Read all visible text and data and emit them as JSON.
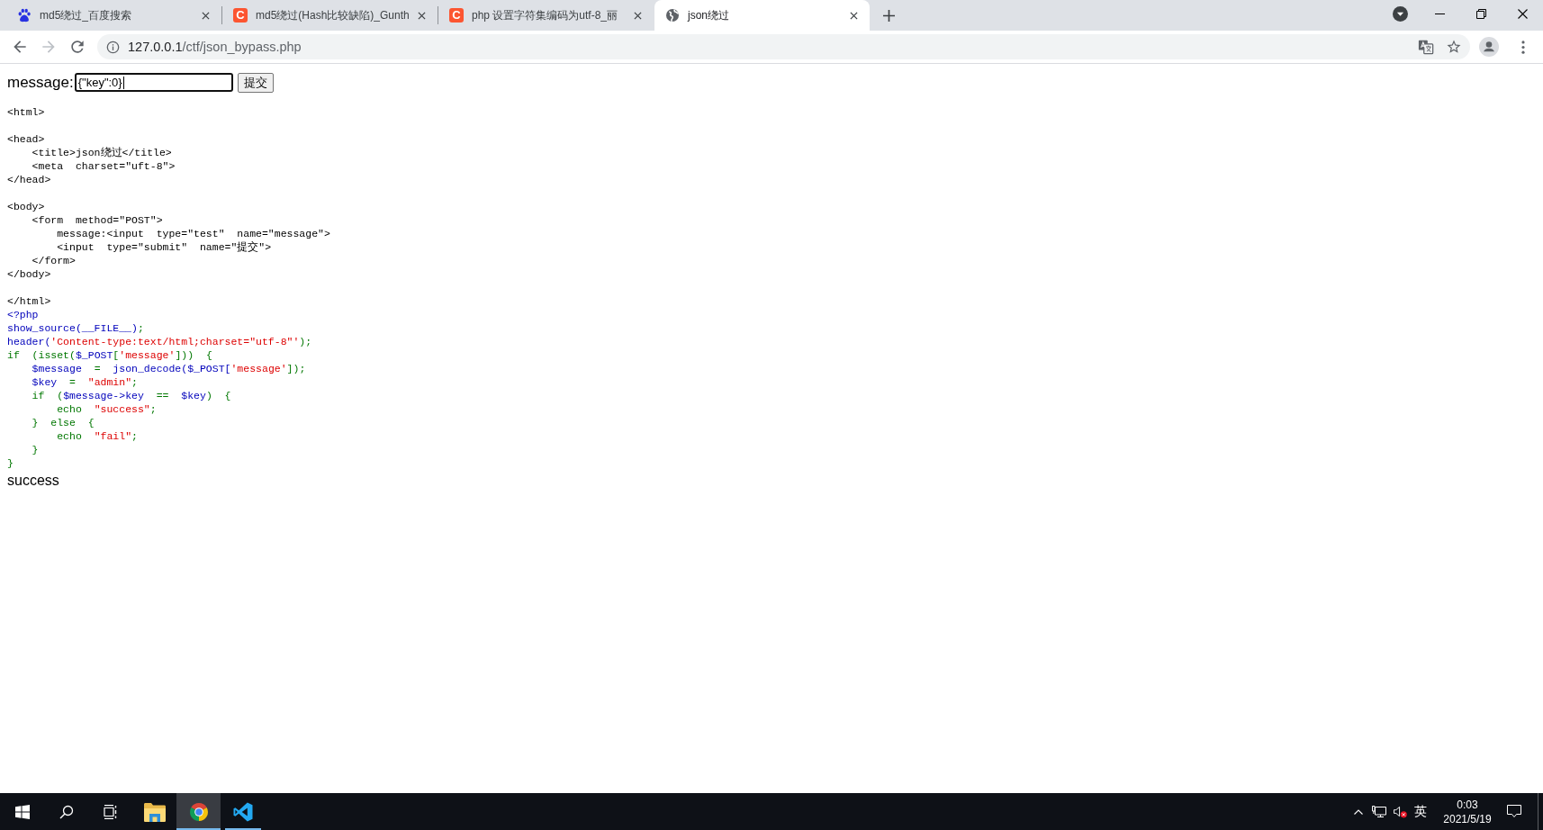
{
  "browser": {
    "tabs": [
      {
        "title": "md5绕过_百度搜索",
        "kind": "paw",
        "selected": false
      },
      {
        "title": "md5绕过(Hash比较缺陷)_Gunth",
        "kind": "letter",
        "favicon_letter": "C",
        "selected": false
      },
      {
        "title": "php 设置字符集编码为utf-8_丽",
        "kind": "letter",
        "favicon_letter": "C",
        "selected": false
      },
      {
        "title": "json绕过",
        "kind": "globe",
        "selected": true
      }
    ],
    "can_go_forward": false,
    "address_bar": {
      "host": "127.0.0.1",
      "path": "/ctf/json_bypass.php"
    }
  },
  "page": {
    "form": {
      "label": "message:",
      "input_value": "{\"key\":0}",
      "focused": true,
      "submit": "提交"
    },
    "source": {
      "blocks": [
        {
          "lines": [
            [
              {
                "kind": "html",
                "text": "<html>"
              }
            ]
          ]
        },
        {
          "lines": [
            [
              {
                "kind": "html",
                "text": "<head>"
              }
            ],
            [
              {
                "kind": "html",
                "text": "    <title>json绕过</title>"
              }
            ],
            [
              {
                "kind": "html",
                "text": "    <meta  charset=\"uft-8\">"
              }
            ],
            [
              {
                "kind": "html",
                "text": "</head>"
              }
            ]
          ]
        },
        {
          "lines": [
            [
              {
                "kind": "html",
                "text": "<body>"
              }
            ],
            [
              {
                "kind": "html",
                "text": "    <form  method=\"POST\">"
              }
            ],
            [
              {
                "kind": "html",
                "text": "        message:<input  type=\"test\"  name=\"message\">"
              }
            ],
            [
              {
                "kind": "html",
                "text": "        <input  type=\"submit\"  name=\"提交\">"
              }
            ],
            [
              {
                "kind": "html",
                "text": "    </form>"
              }
            ],
            [
              {
                "kind": "html",
                "text": "</body>"
              }
            ]
          ]
        },
        {
          "lines": [
            [
              {
                "kind": "html",
                "text": "</html>"
              }
            ],
            [
              {
                "kind": "default",
                "text": "<?php"
              }
            ],
            [
              {
                "kind": "default",
                "text": "show_source(__FILE__)"
              },
              {
                "kind": "keyword",
                "text": ";"
              }
            ],
            [
              {
                "kind": "default",
                "text": "header("
              },
              {
                "kind": "string",
                "text": "'Content-type:text/html;charset=\"utf-8\"'"
              },
              {
                "kind": "keyword",
                "text": ");"
              }
            ],
            [
              {
                "kind": "keyword",
                "text": "if  (isset("
              },
              {
                "kind": "default",
                "text": "$_POST"
              },
              {
                "kind": "keyword",
                "text": "["
              },
              {
                "kind": "string",
                "text": "'message'"
              },
              {
                "kind": "keyword",
                "text": "]))  {"
              }
            ],
            [
              {
                "kind": "default",
                "text": "    $message"
              },
              {
                "kind": "keyword",
                "text": "  =  "
              },
              {
                "kind": "default",
                "text": "json_decode($_POST["
              },
              {
                "kind": "string",
                "text": "'message'"
              },
              {
                "kind": "keyword",
                "text": "]);"
              }
            ],
            [
              {
                "kind": "default",
                "text": "    $key"
              },
              {
                "kind": "keyword",
                "text": "  =  "
              },
              {
                "kind": "string",
                "text": "\"admin\""
              },
              {
                "kind": "keyword",
                "text": ";"
              }
            ],
            [
              {
                "kind": "keyword",
                "text": "    if  ("
              },
              {
                "kind": "default",
                "text": "$message->key"
              },
              {
                "kind": "keyword",
                "text": "  ==  "
              },
              {
                "kind": "default",
                "text": "$key"
              },
              {
                "kind": "keyword",
                "text": ")  {"
              }
            ],
            [
              {
                "kind": "keyword",
                "text": "        echo  "
              },
              {
                "kind": "string",
                "text": "\"success\""
              },
              {
                "kind": "keyword",
                "text": ";"
              }
            ],
            [
              {
                "kind": "keyword",
                "text": "    }  else  {"
              }
            ],
            [
              {
                "kind": "keyword",
                "text": "        echo  "
              },
              {
                "kind": "string",
                "text": "\"fail\""
              },
              {
                "kind": "keyword",
                "text": ";"
              }
            ],
            [
              {
                "kind": "keyword",
                "text": "    }"
              }
            ],
            [
              {
                "kind": "keyword",
                "text": "}"
              }
            ]
          ]
        }
      ]
    },
    "output": "success"
  },
  "taskbar": {
    "apps": [
      {
        "kind": "folder",
        "running": false,
        "selected": false
      },
      {
        "kind": "browser",
        "running": true,
        "selected": true
      },
      {
        "kind": "editor",
        "running": true,
        "selected": false
      }
    ],
    "tray": {
      "volume_muted": true,
      "input_method": "英",
      "time": "0:03",
      "date": "2021/5/19"
    }
  }
}
